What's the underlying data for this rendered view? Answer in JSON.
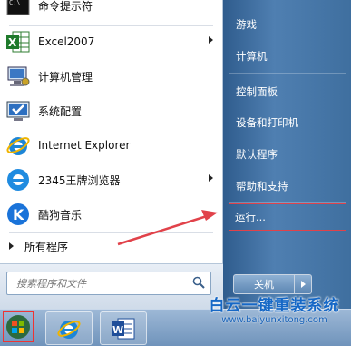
{
  "left_pane": {
    "items": [
      {
        "label": "命令提示符",
        "icon": "cmd-icon",
        "has_submenu": false
      },
      {
        "label": "Excel2007",
        "icon": "excel-icon",
        "has_submenu": true
      },
      {
        "label": "计算机管理",
        "icon": "computer-management-icon",
        "has_submenu": false
      },
      {
        "label": "系统配置",
        "icon": "system-config-icon",
        "has_submenu": false
      },
      {
        "label": "Internet Explorer",
        "icon": "ie-icon",
        "has_submenu": false
      },
      {
        "label": "2345王牌浏览器",
        "icon": "browser-2345-icon",
        "has_submenu": true
      },
      {
        "label": "酷狗音乐",
        "icon": "kugou-icon",
        "has_submenu": false
      }
    ],
    "all_programs": "所有程序",
    "search_placeholder": "搜索程序和文件"
  },
  "right_pane": {
    "items": [
      {
        "label": "游戏"
      },
      {
        "label": "计算机"
      },
      {
        "label": "控制面板"
      },
      {
        "label": "设备和打印机"
      },
      {
        "label": "默认程序"
      },
      {
        "label": "帮助和支持"
      },
      {
        "label": "运行..."
      }
    ],
    "shutdown_label": "关机"
  },
  "watermark": {
    "title": "白云一键重装系统",
    "url": "www.baiyunxitong.com"
  },
  "colors": {
    "highlight": "#e1424a",
    "watermark": "#1668c6"
  }
}
